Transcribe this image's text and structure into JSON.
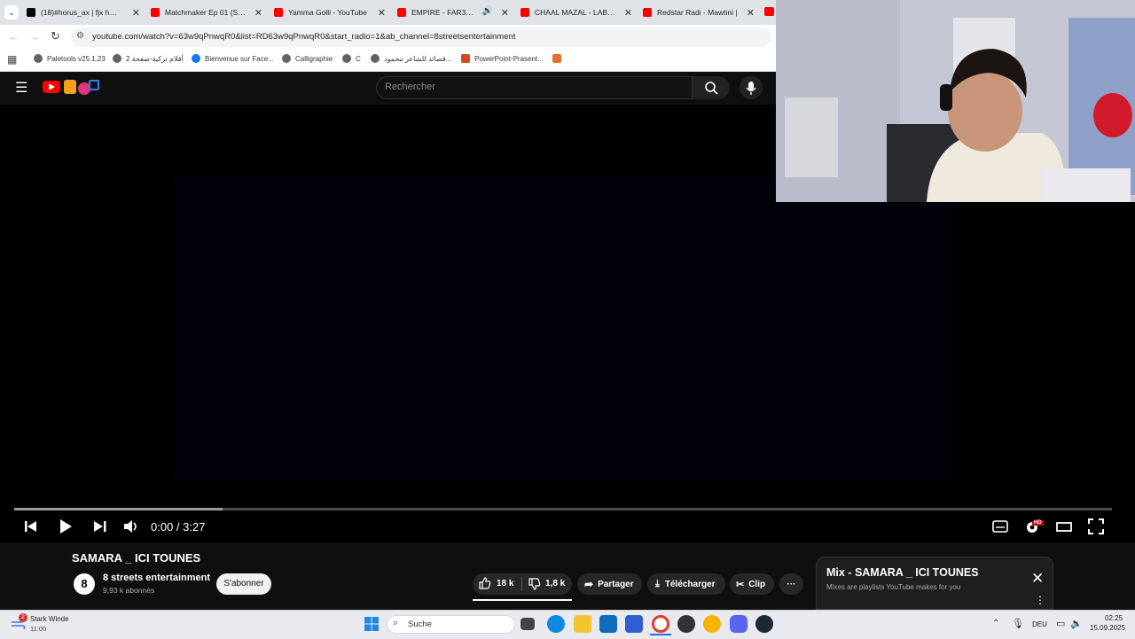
{
  "browser": {
    "tabs": [
      {
        "title": "(18)#horus_ax | fjx horus",
        "favicon": "tiktok-icon"
      },
      {
        "title": "Matchmaker Ep 01 (Speed",
        "favicon": "youtube-icon"
      },
      {
        "title": "Yamma Golli - YouTube",
        "favicon": "youtube-icon"
      },
      {
        "title": "EMPIRE - FAR3OUN -",
        "favicon": "youtube-icon",
        "audio": true
      },
      {
        "title": "CHAAL MAZAL - LABESS",
        "favicon": "youtube-icon"
      },
      {
        "title": "Redstar Radi - Mawtini |",
        "favicon": "youtube-icon"
      }
    ],
    "url": "youtube.com/watch?v=63w9qPnwqR0&list=RD63w9qPnwqR0&start_radio=1&ab_channel=8streetsentertainment",
    "bookmarks": [
      {
        "label": "Paletools v25.1.23"
      },
      {
        "label": "أفلام تركية-صفحة 2"
      },
      {
        "label": "Bienvenue sur Face..."
      },
      {
        "label": "Calligraphie"
      },
      {
        "label": "C"
      },
      {
        "label": "قصائد للشاعر محمود..."
      },
      {
        "label": "PowerPoint-Prasent..."
      }
    ]
  },
  "youtube": {
    "search_placeholder": "Rechercher",
    "player": {
      "time": "0:00 / 3:27",
      "progress_buffered": 0.19,
      "hd_badge": "HD"
    },
    "video": {
      "title": "SAMARA _ ICI TOUNES",
      "channel": "8 streets entertainment",
      "subscribers": "9,93 k abonnés",
      "subscribe_label": "S'abonner",
      "likes": "18 k",
      "dislikes": "1,8 k",
      "share_label": "Partager",
      "download_label": "Télécharger",
      "clip_label": "Clip",
      "more_label": "···"
    },
    "mix": {
      "title": "Mix - SAMARA _ ICI TOUNES",
      "subtitle": "Mixes are playlists YouTube makes for you"
    }
  },
  "taskbar": {
    "weather_badge": "2",
    "weather_title": "Stark Winde",
    "weather_time": "11:00",
    "search_label": "Suche",
    "lang": "DEU",
    "clock_time": "02:25",
    "clock_date": "15.09.2025"
  },
  "colors": {
    "youtube_red": "#ff0000",
    "player_bg": "#000000",
    "page_bg": "#0f0f0f",
    "taskbar_bg": "#e8eaee"
  }
}
